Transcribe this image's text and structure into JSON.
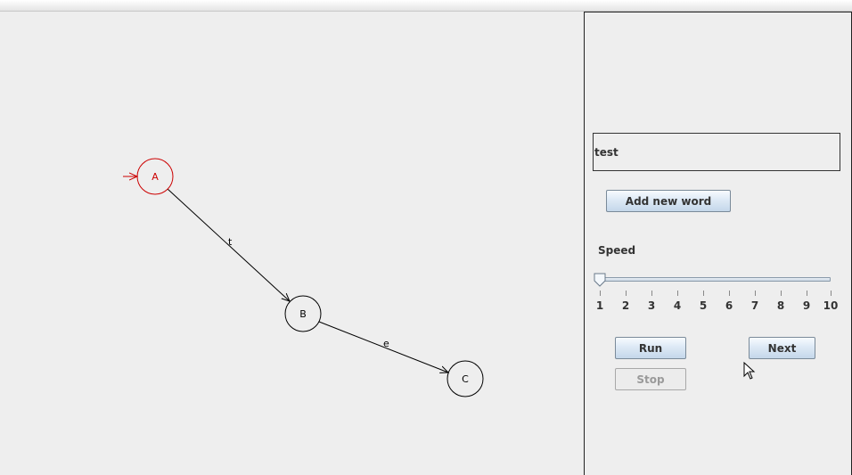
{
  "graph": {
    "nodes": [
      {
        "id": "A",
        "label": "A",
        "initial": true,
        "color": "#cc0000"
      },
      {
        "id": "B",
        "label": "B",
        "initial": false,
        "color": "#000000"
      },
      {
        "id": "C",
        "label": "C",
        "initial": false,
        "color": "#000000"
      }
    ],
    "edges": [
      {
        "from": "A",
        "to": "B",
        "label": "t"
      },
      {
        "from": "B",
        "to": "C",
        "label": "e"
      }
    ]
  },
  "panel": {
    "word_value": "test",
    "add_word_label": "Add new word",
    "speed_label": "Speed",
    "speed": {
      "min": 1,
      "max": 10,
      "value": 1,
      "ticks": [
        "1",
        "2",
        "3",
        "4",
        "5",
        "6",
        "7",
        "8",
        "9",
        "10"
      ]
    },
    "run_label": "Run",
    "next_label": "Next",
    "stop_label": "Stop",
    "stop_enabled": false
  },
  "colors": {
    "initial_state": "#cc0000",
    "button_top": "#f7fbff",
    "button_bottom": "#c4d7ea"
  }
}
